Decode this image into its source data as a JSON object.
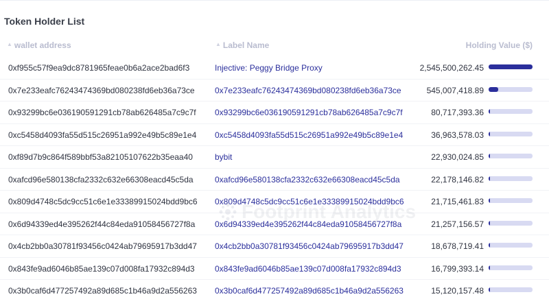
{
  "title": "Token Holder List",
  "columns": {
    "wallet": "wallet address",
    "label": "Label Name",
    "value": "Holding Value ($)"
  },
  "watermark": "Footprint Analytics",
  "colors": {
    "bar_fill": "#2b2f9c",
    "bar_track": "#d8daf2",
    "label_text": "#2b2f9c"
  },
  "rows": [
    {
      "wallet": "0xf955c57f9ea9dc8781965feae0b6a2ace2bad6f3",
      "label": "Injective: Peggy Bridge Proxy",
      "value": "2,545,500,262.45",
      "fraction": 1.0
    },
    {
      "wallet": "0x7e233eafc76243474369bd080238fd6eb36a73ce",
      "label": "0x7e233eafc76243474369bd080238fd6eb36a73ce",
      "value": "545,007,418.89",
      "fraction": 0.214
    },
    {
      "wallet": "0x93299bc6e036190591291cb78ab626485a7c9c7f",
      "label": "0x93299bc6e036190591291cb78ab626485a7c9c7f",
      "value": "80,717,393.36",
      "fraction": 0.032
    },
    {
      "wallet": "0xc5458d4093fa55d515c26951a992e49b5c89e1e4",
      "label": "0xc5458d4093fa55d515c26951a992e49b5c89e1e4",
      "value": "36,963,578.03",
      "fraction": 0.015
    },
    {
      "wallet": "0xf89d7b9c864f589bbf53a82105107622b35eaa40",
      "label": "bybit",
      "value": "22,930,024.85",
      "fraction": 0.009
    },
    {
      "wallet": "0xafcd96e580138cfa2332c632e66308eacd45c5da",
      "label": "0xafcd96e580138cfa2332c632e66308eacd45c5da",
      "value": "22,178,146.82",
      "fraction": 0.009
    },
    {
      "wallet": "0x809d4748c5dc9cc51c6e1e33389915024bdd9bc6",
      "label": "0x809d4748c5dc9cc51c6e1e33389915024bdd9bc6",
      "value": "21,715,461.83",
      "fraction": 0.009
    },
    {
      "wallet": "0x6d94339ed4e395262f44c84eda91058456727f8a",
      "label": "0x6d94339ed4e395262f44c84eda91058456727f8a",
      "value": "21,257,156.57",
      "fraction": 0.008
    },
    {
      "wallet": "0x4cb2bb0a30781f93456c0424ab79695917b3dd47",
      "label": "0x4cb2bb0a30781f93456c0424ab79695917b3dd47",
      "value": "18,678,719.41",
      "fraction": 0.007
    },
    {
      "wallet": "0x843fe9ad6046b85ae139c07d008fa17932c894d3",
      "label": "0x843fe9ad6046b85ae139c07d008fa17932c894d3",
      "value": "16,799,393.14",
      "fraction": 0.007
    },
    {
      "wallet": "0x3b0caf6d477257492a89d685c1b46a9d2a556263",
      "label": "0x3b0caf6d477257492a89d685c1b46a9d2a556263",
      "value": "15,120,157.48",
      "fraction": 0.006
    }
  ]
}
